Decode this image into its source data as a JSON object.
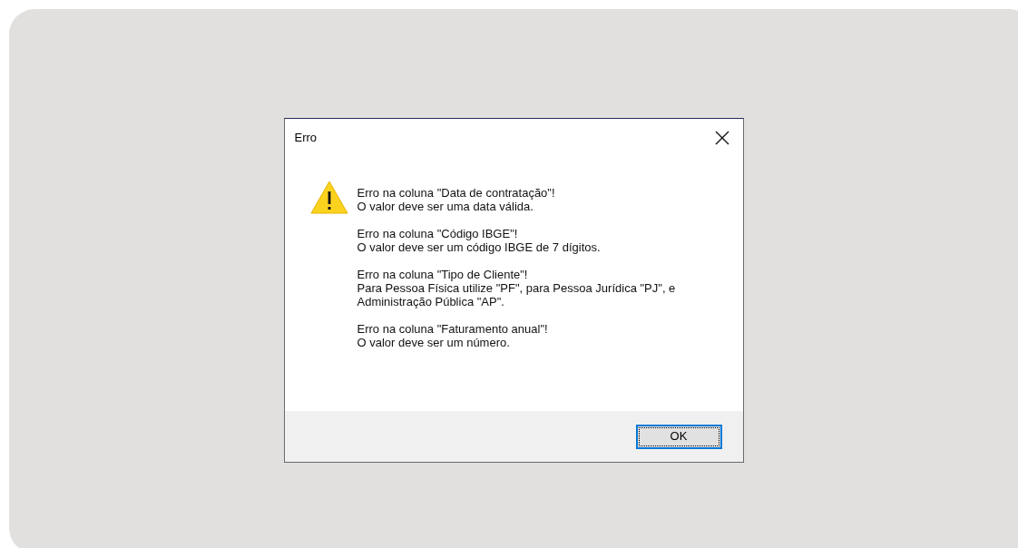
{
  "dialog": {
    "title": "Erro",
    "messages": [
      [
        "Erro na coluna \"Data de contratação\"!",
        "O valor deve ser uma data válida."
      ],
      [
        "Erro na coluna \"Código IBGE\"!",
        "O valor deve ser um código IBGE de 7 dígitos."
      ],
      [
        "Erro na coluna \"Tipo de Cliente\"!",
        "Para Pessoa Física utilize \"PF\", para Pessoa Jurídica \"PJ\", e",
        "Administração Pública \"AP\"."
      ],
      [
        "Erro na coluna \"Faturamento anual\"!",
        "O valor deve ser um número."
      ]
    ],
    "buttons": [
      {
        "label": "OK",
        "focused": true
      }
    ]
  }
}
